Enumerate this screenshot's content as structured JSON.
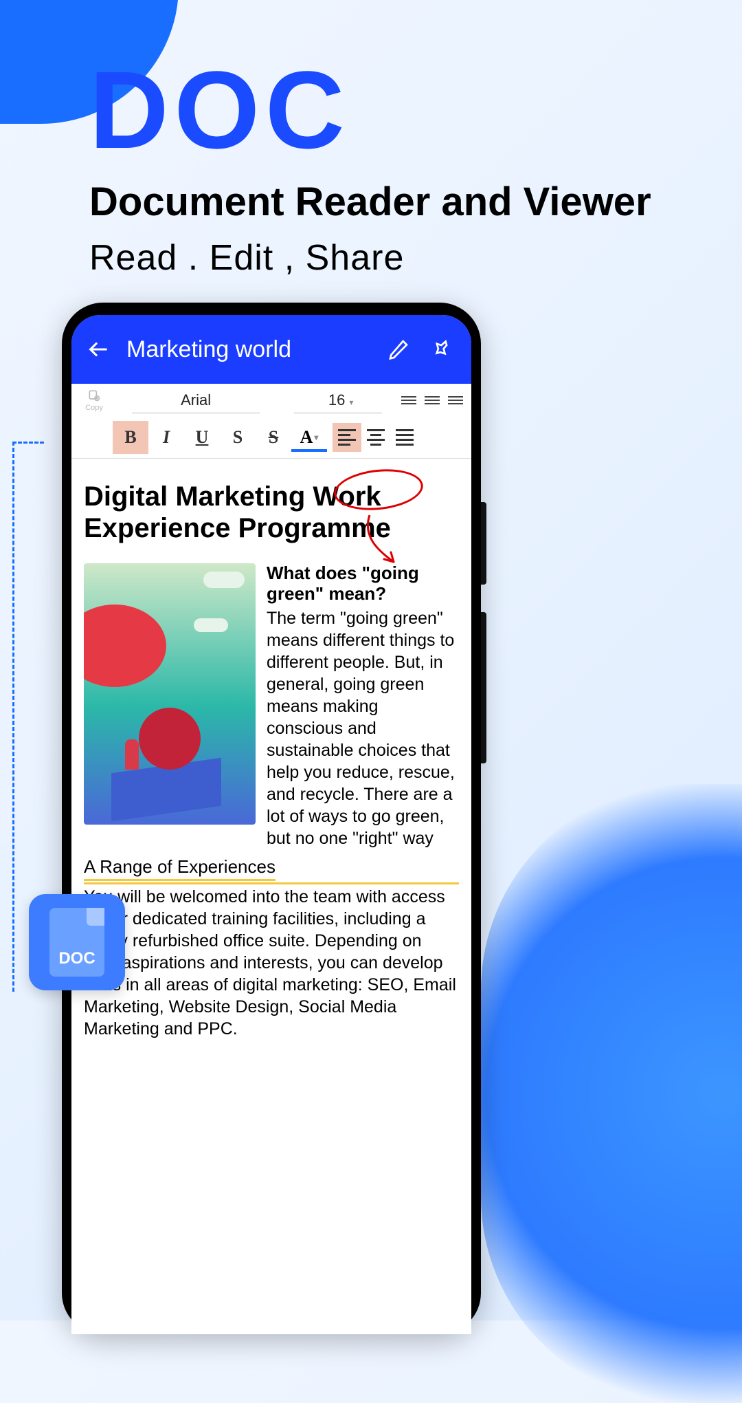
{
  "promo": {
    "title": "DOC",
    "subtitle": "Document Reader and Viewer",
    "tagline": "Read . Edit , Share",
    "badge_label": "DOC"
  },
  "app_header": {
    "title": "Marketing world"
  },
  "toolbar": {
    "copy_label": "Copy",
    "font_name": "Arial",
    "font_size": "16",
    "buttons": {
      "bold": "B",
      "italic": "I",
      "underline": "U",
      "S": "S",
      "strike": "S",
      "font_color": "A"
    }
  },
  "document": {
    "title": "Digital Marketing Work Experience Programme",
    "subheading": "What does \"going green\" mean?",
    "paragraph1": "The term \"going green\" means different things to different people. But, in general, going green means making conscious and sustainable choices that help you reduce, rescue, and recycle. There are a lot of ways to go green, but no one \"right\" way",
    "section2_title": "A Range of Experiences",
    "section2_body": "You will be welcomed into the team with access to our dedicated training facilities, including a newly refurbished office suite. Depending on your aspirations and interests, you can develop skills in all areas of digital marketing: SEO, Email Marketing, Website Design, Social Media Marketing and PPC."
  }
}
